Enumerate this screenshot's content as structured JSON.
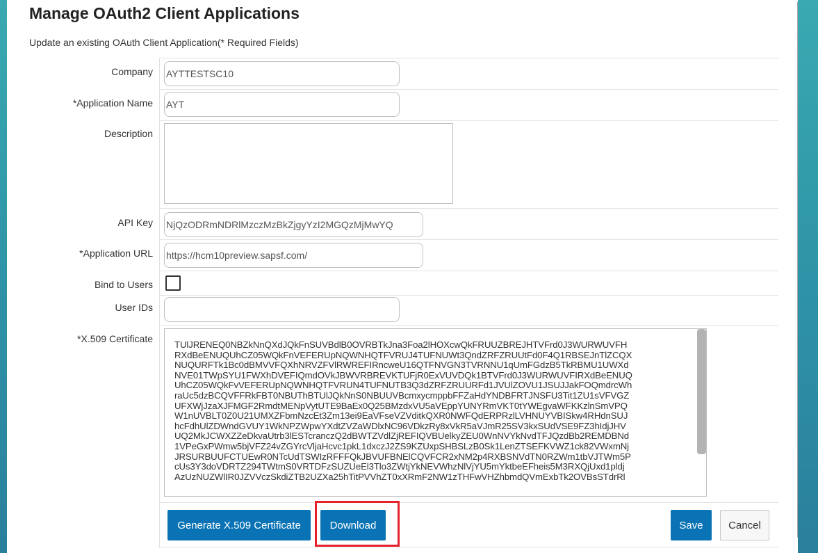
{
  "page": {
    "title": "Manage OAuth2 Client Applications",
    "subtitle": "Update an existing OAuth Client Application(* Required Fields)"
  },
  "form": {
    "company": {
      "label": "Company",
      "value": "AYTTESTSC10"
    },
    "application_name": {
      "label": "*Application Name",
      "value": "AYT"
    },
    "description": {
      "label": "Description",
      "value": ""
    },
    "api_key": {
      "label": "API Key",
      "value": "NjQzODRmNDRlMzczMzBkZjgyYzI2MGQzMjMwYQ"
    },
    "application_url": {
      "label": "*Application URL",
      "value": "https://hcm10preview.sapsf.com/"
    },
    "bind_to_users": {
      "label": "Bind to Users",
      "checked": false
    },
    "user_ids": {
      "label": "User IDs",
      "value": ""
    },
    "certificate": {
      "label": "*X.509 Certificate",
      "value": "TUlJRENEQ0NBZkNnQXdJQkFnSUVBdlB0OVRBTkJna3Foa2lHOXcwQkFRUUZBREJHTVFrd0J3WURWUVFH\nRXdBeENUQUhCZ05WQkFnVEFERUpNQWNHQTFVRUJ4TUFNUWt3QndZRFZRUUtFd0F4Q1RBSEJnTlZCQX\nNUQURFTk1Bc0dBMVVFQXhNRVZFVlRWREFIRncweU16QTFNVGN3TVRNNU1qUmFGdzB5TkRBMU1UWXd\nNVE01TWpSYU1FWXhDVEFIQmdOVkJBWVRBREVKTUFjR0ExVUVDQk1BTVFrd0J3WURWUVFIRXdBeENUQ\nUhCZ05WQkFvVEFERUpNQWNHQTFVRUN4TUFNUTB3Q3dZRFZRUURFd1JVUlZOVU1JSUJJakFOQmdrcWh\nraUc5dzBCQVFFRkFBT0NBUThBTUlJQkNnS0NBUUVBcmxycmppbFFZaHdYNDBFRTJNSFU3Tit1ZU1sVFVGZ\nUFXWjJzaXJFMGF2RmdtMENpVytUTE9BaEx0Q25BMzdxVU5aVEppYUNYRmVKT0tYWEgvaWFKKzlnSmVPQ\nW1nUVBLT0Z0U21UMXZFbmNzcEt3Zm13ei9EaVFseVZVditkQXR0NWFQdERPRzlLVHNUYVBISkw4RHdnSUJ\nhcFdhUlZDWndGVUY1WkNPZWpwYXdtZVZaWDlxNC96VDkzRy8xVkR5aVJmR25SV3kxSUdVSE9FZ3hIdjJHV\nUQ2MkJCWXZZeDkvaUtrb3lESTcranczQ2dBWTZVdlZjREFIQVBUelkyZEU0WnNVYkNvdTFJQzdBb2REMDBNd\n1VPeGxPWmw5bjVFZ24vZGYrcVljaHcvc1pkL1dxczJ2ZS9KZUxpSHBSLzB0Sk1LenZTSEFKVWZ1ck82VWxmNj\nJRSURBUUFCTUEwR0NTcUdTSWIzRFFFQkJBVUFBNElCQVFCR2xNM2p4RXBSNVdTN0RZWm1tbVJTWm5P\ncUs3Y3doVDRTZ294TWtmS0VRTDFzSUZUeEl3Tlo3ZWtjYkNEVWhzNlVjYU5mYktbeEFheis5M3RXQjUxd1pldj\nAzUzNUZWlIR0JZVVczSkdiZTB2UZXa25hTitPVVhZT0xXRmF2NW1zTHFwVHZhbmdQVmExbTk2OVBsSTdrRl"
    }
  },
  "buttons": {
    "generate": "Generate X.509 Certificate",
    "download": "Download",
    "save": "Save",
    "cancel": "Cancel"
  },
  "colors": {
    "primary": "#0a73b5",
    "highlight": "#e8202a",
    "background": "#3aa9b1"
  }
}
